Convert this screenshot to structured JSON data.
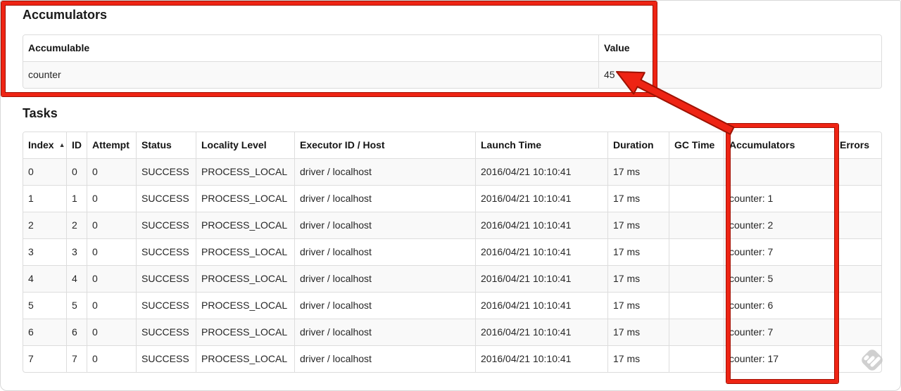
{
  "accumulators_section": {
    "heading": "Accumulators",
    "table": {
      "headers": [
        "Accumulable",
        "Value"
      ],
      "rows": [
        [
          "counter",
          "45"
        ]
      ]
    }
  },
  "tasks_section": {
    "heading": "Tasks",
    "table": {
      "headers": [
        "Index",
        "ID",
        "Attempt",
        "Status",
        "Locality Level",
        "Executor ID / Host",
        "Launch Time",
        "Duration",
        "GC Time",
        "Accumulators",
        "Errors"
      ],
      "sort_icon": "▲",
      "rows": [
        [
          "0",
          "0",
          "0",
          "SUCCESS",
          "PROCESS_LOCAL",
          "driver / localhost",
          "2016/04/21 10:10:41",
          "17 ms",
          "",
          "",
          ""
        ],
        [
          "1",
          "1",
          "0",
          "SUCCESS",
          "PROCESS_LOCAL",
          "driver / localhost",
          "2016/04/21 10:10:41",
          "17 ms",
          "",
          "counter: 1",
          ""
        ],
        [
          "2",
          "2",
          "0",
          "SUCCESS",
          "PROCESS_LOCAL",
          "driver / localhost",
          "2016/04/21 10:10:41",
          "17 ms",
          "",
          "counter: 2",
          ""
        ],
        [
          "3",
          "3",
          "0",
          "SUCCESS",
          "PROCESS_LOCAL",
          "driver / localhost",
          "2016/04/21 10:10:41",
          "17 ms",
          "",
          "counter: 7",
          ""
        ],
        [
          "4",
          "4",
          "0",
          "SUCCESS",
          "PROCESS_LOCAL",
          "driver / localhost",
          "2016/04/21 10:10:41",
          "17 ms",
          "",
          "counter: 5",
          ""
        ],
        [
          "5",
          "5",
          "0",
          "SUCCESS",
          "PROCESS_LOCAL",
          "driver / localhost",
          "2016/04/21 10:10:41",
          "17 ms",
          "",
          "counter: 6",
          ""
        ],
        [
          "6",
          "6",
          "0",
          "SUCCESS",
          "PROCESS_LOCAL",
          "driver / localhost",
          "2016/04/21 10:10:41",
          "17 ms",
          "",
          "counter: 7",
          ""
        ],
        [
          "7",
          "7",
          "0",
          "SUCCESS",
          "PROCESS_LOCAL",
          "driver / localhost",
          "2016/04/21 10:10:41",
          "17 ms",
          "",
          "counter: 17",
          ""
        ]
      ]
    }
  },
  "annotations": {
    "highlight_color": "#ee2414",
    "highlight_outline_color": "#a31104"
  },
  "watermark": {
    "icon": "feedly-logo",
    "color": "#c8c8c8"
  }
}
